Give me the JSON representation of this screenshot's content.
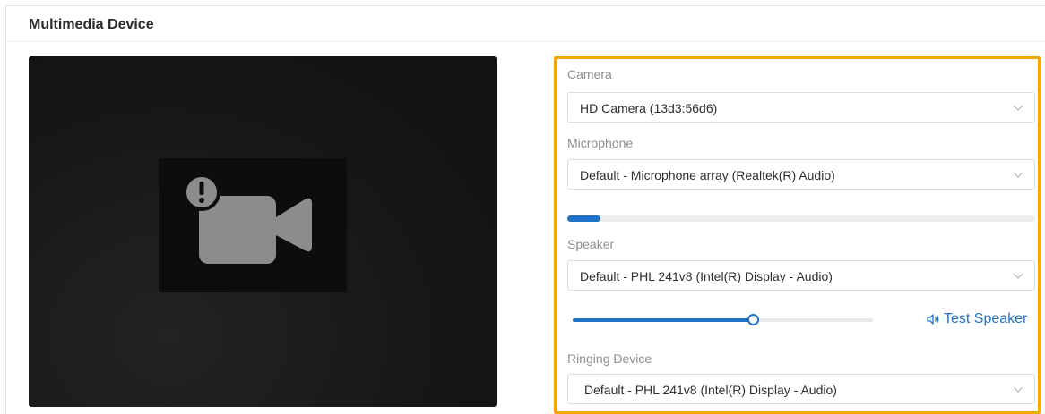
{
  "panel": {
    "title": "Multimedia Device"
  },
  "camera": {
    "label": "Camera",
    "selected": "HD Camera (13d3:56d6)"
  },
  "microphone": {
    "label": "Microphone",
    "selected": "Default - Microphone array (Realtek(R) Audio)",
    "input_level": 0.07
  },
  "speaker": {
    "label": "Speaker",
    "selected": "Default - PHL 241v8 (Intel(R) Display - Audio)",
    "volume": 0.6,
    "test_label": "Test Speaker"
  },
  "ringing": {
    "label": "Ringing Device",
    "selected": "Default - PHL 241v8 (Intel(R) Display - Audio)"
  },
  "icons": {
    "preview": "camera-error-icon",
    "dropdown": "chevron-down-icon",
    "speaker": "speaker-icon"
  },
  "colors": {
    "accent": "#1e72c8",
    "highlight_border": "#f2a900"
  }
}
